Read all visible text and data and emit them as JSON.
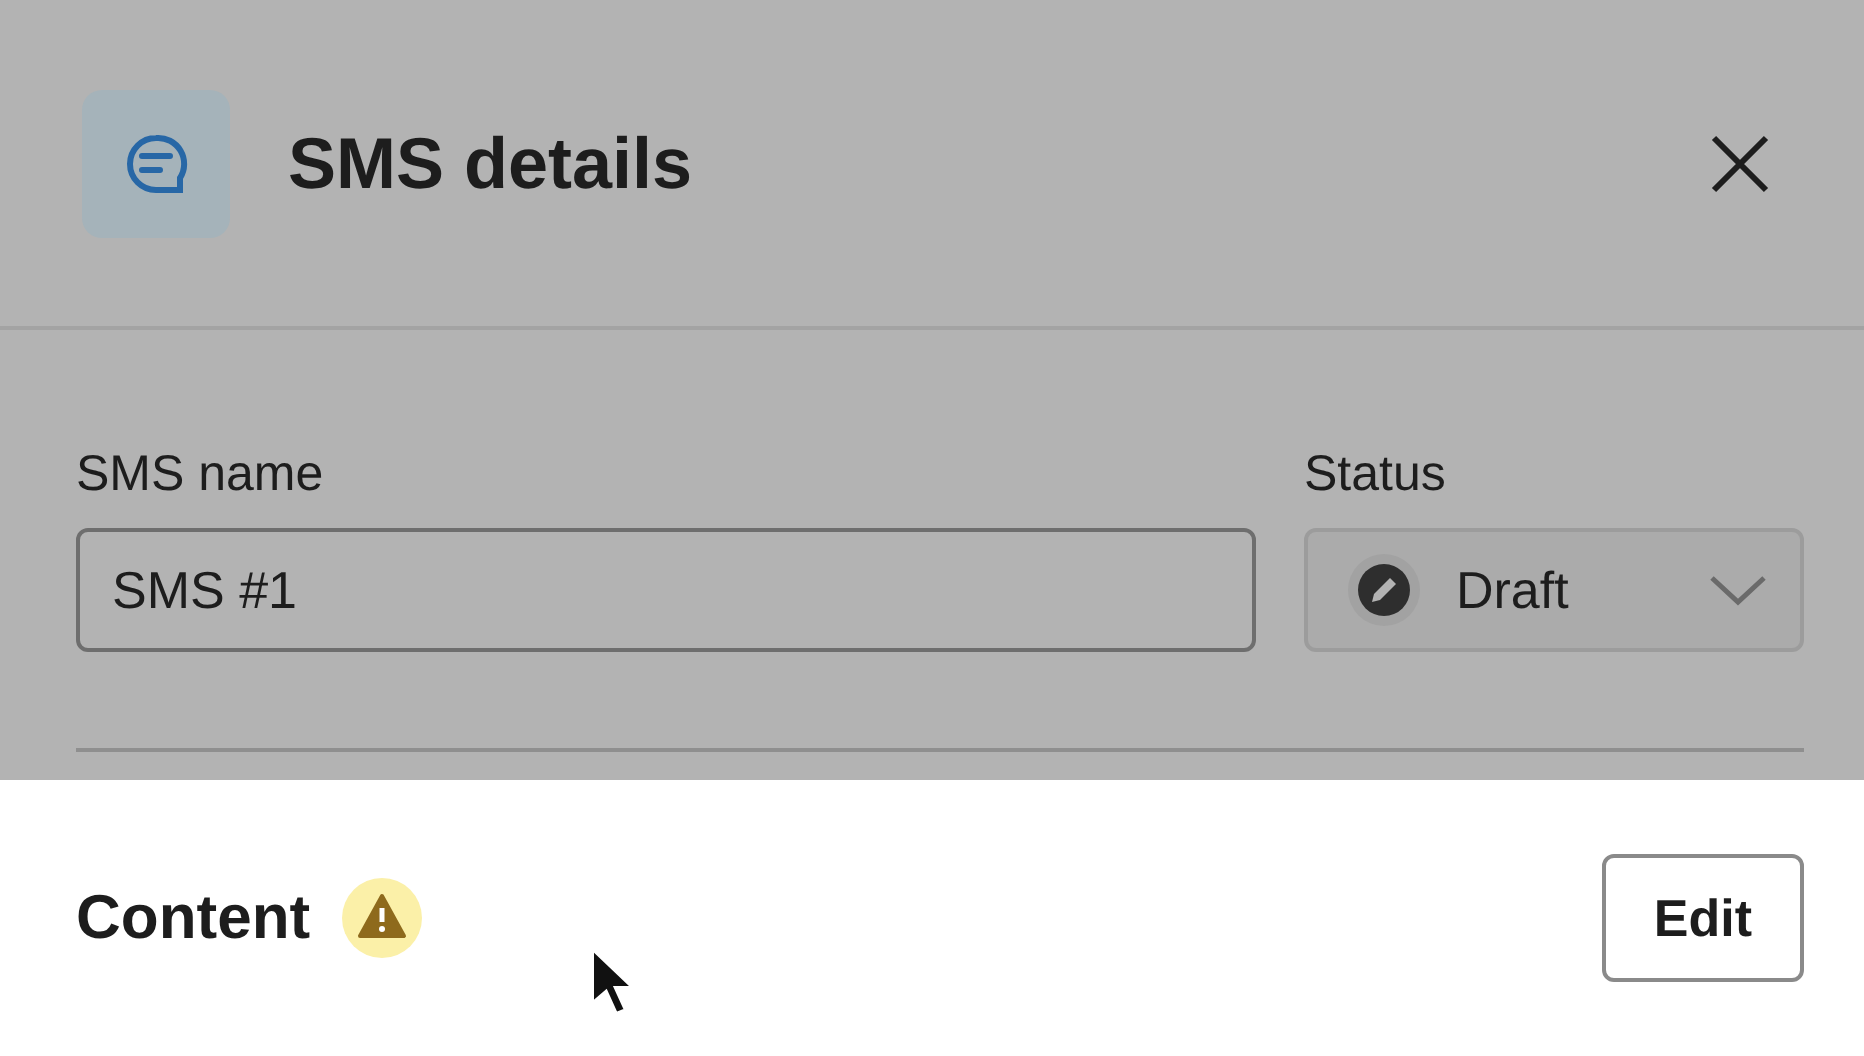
{
  "header": {
    "title": "SMS details"
  },
  "fields": [
    {
      "kind": "text",
      "label": "SMS name",
      "value": "SMS #1"
    },
    {
      "kind": "select",
      "label": "Status",
      "value": "Draft"
    }
  ],
  "content_section": {
    "title": "Content",
    "warning": true,
    "button": "Edit"
  }
}
